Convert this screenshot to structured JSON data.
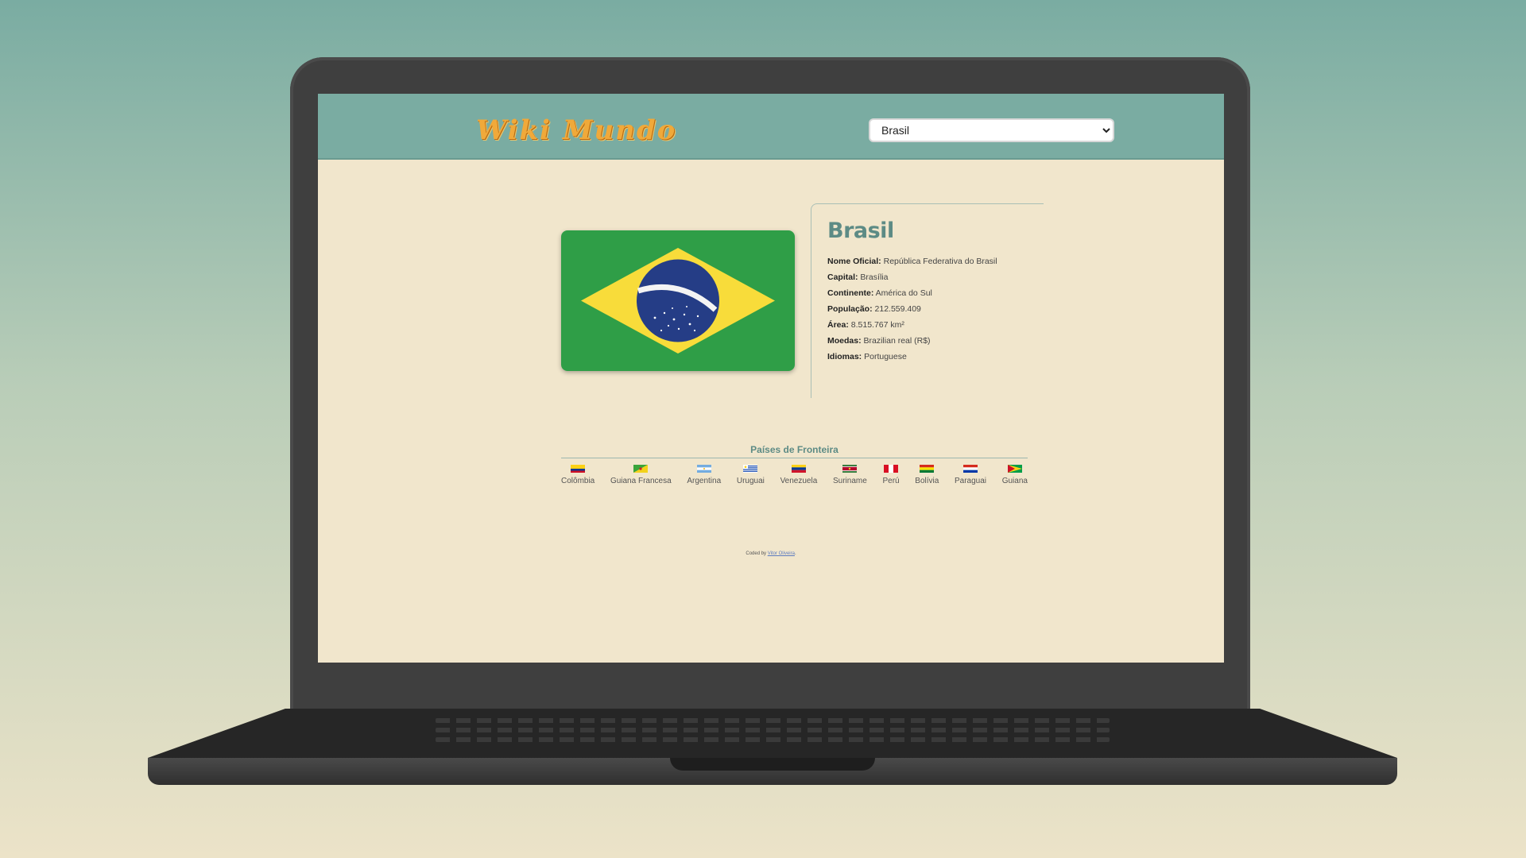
{
  "header": {
    "logo_text": "Wiki Mundo",
    "select_value": "Brasil",
    "select_options": [
      "Brasil"
    ]
  },
  "country": {
    "name": "Brasil",
    "fields": [
      {
        "label": "Nome Oficial:",
        "value": " República Federativa do Brasil"
      },
      {
        "label": "Capital:",
        "value": " Brasília"
      },
      {
        "label": "Continente:",
        "value": " América do Sul"
      },
      {
        "label": "População:",
        "value": " 212.559.409"
      },
      {
        "label": "Área:",
        "value": " 8.515.767 km²"
      },
      {
        "label": "Moedas:",
        "value": " Brazilian real (R$)"
      },
      {
        "label": "Idiomas:",
        "value": " Portuguese"
      }
    ]
  },
  "borders": {
    "title": "Países de Fronteira",
    "items": [
      {
        "name": "Colômbia",
        "flag": "colombia-flag-icon"
      },
      {
        "name": "Guiana Francesa",
        "flag": "french-guiana-flag-icon"
      },
      {
        "name": "Argentina",
        "flag": "argentina-flag-icon"
      },
      {
        "name": "Uruguai",
        "flag": "uruguay-flag-icon"
      },
      {
        "name": "Venezuela",
        "flag": "venezuela-flag-icon"
      },
      {
        "name": "Suriname",
        "flag": "suriname-flag-icon"
      },
      {
        "name": "Perú",
        "flag": "peru-flag-icon"
      },
      {
        "name": "Bolívia",
        "flag": "bolivia-flag-icon"
      },
      {
        "name": "Paraguai",
        "flag": "paraguay-flag-icon"
      },
      {
        "name": "Guiana",
        "flag": "guyana-flag-icon"
      }
    ]
  },
  "footer": {
    "prefix": "Coded by ",
    "link_text": "Vitor Oliveira",
    "suffix": "."
  },
  "colors": {
    "header_bg": "#7aaca2",
    "page_bg": "#f1e6cc",
    "accent": "#5d8b85",
    "logo": "#f0a93a"
  }
}
